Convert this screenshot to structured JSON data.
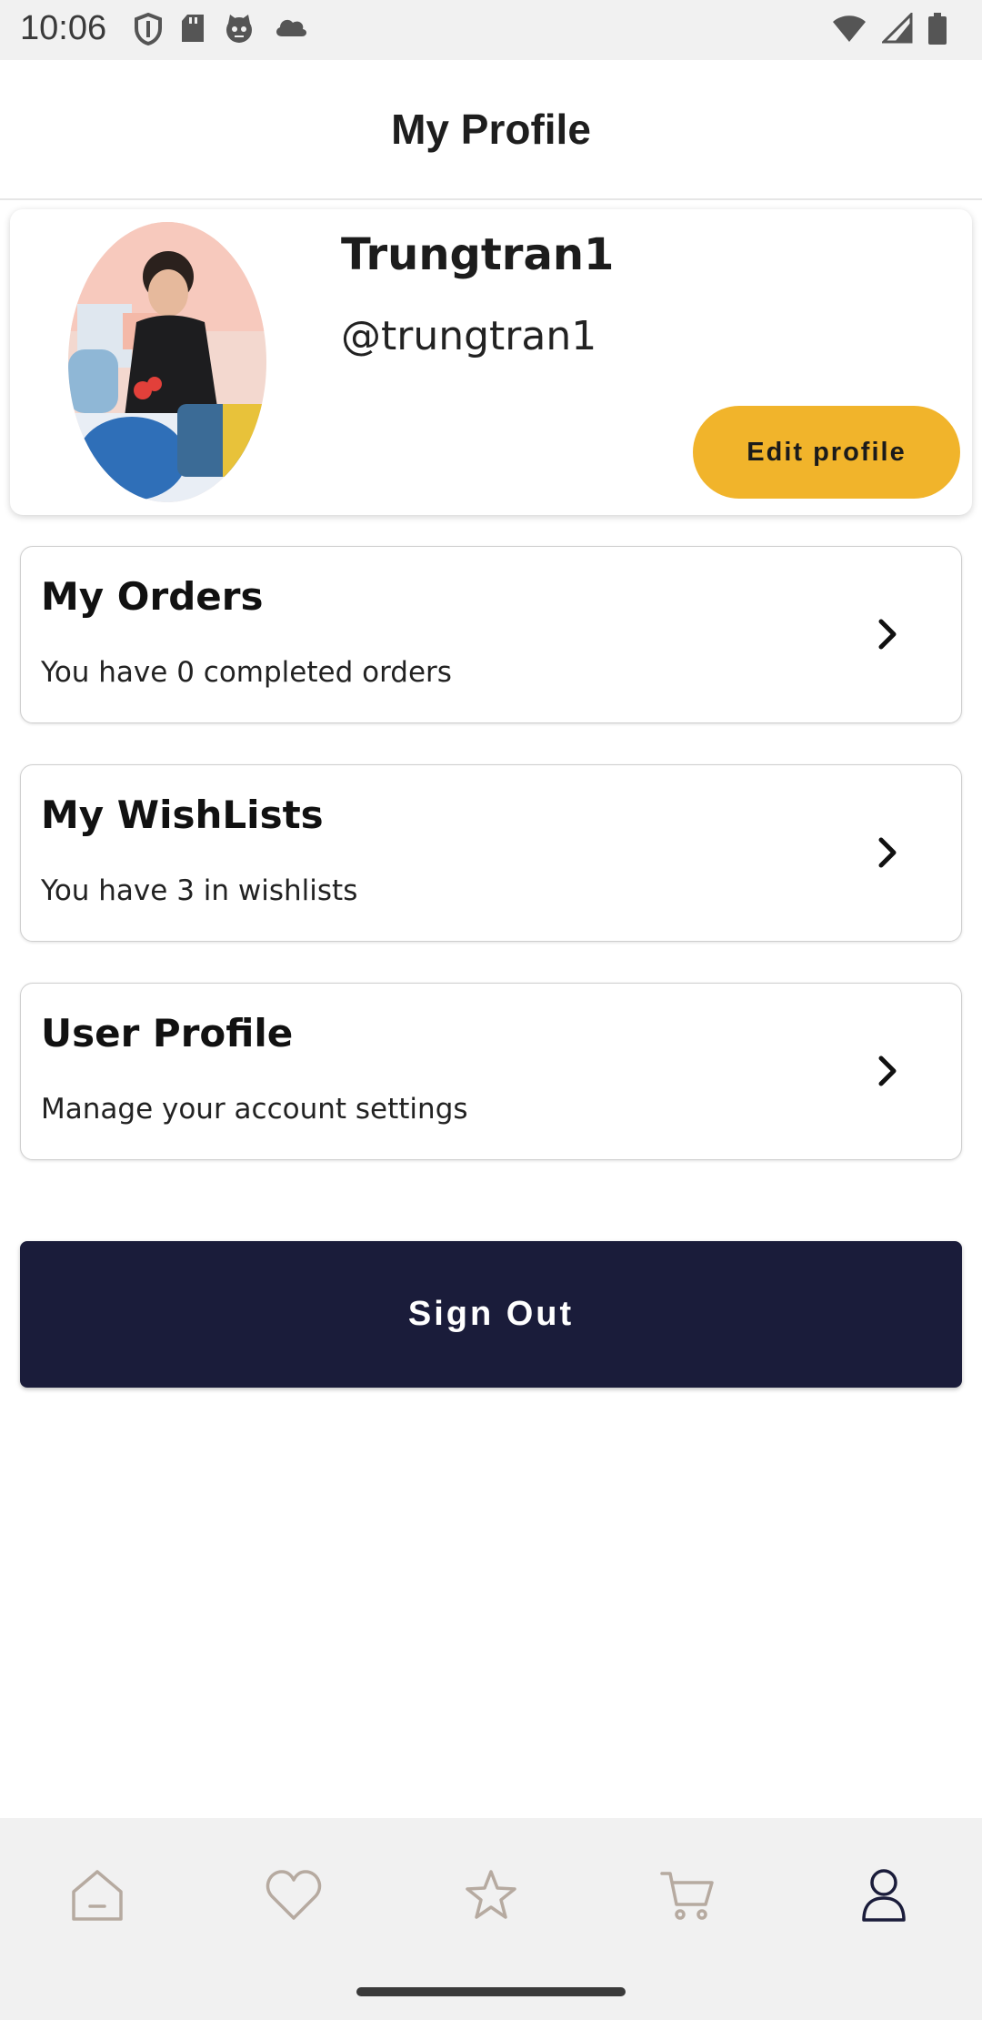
{
  "status_bar": {
    "time": "10:06",
    "left_icons": [
      "shield-icon",
      "sd-card-icon",
      "cat-face-icon",
      "cloud-icon"
    ],
    "right_icons": [
      "wifi-icon",
      "cellular-signal-icon",
      "battery-icon"
    ]
  },
  "header": {
    "title": "My Profile"
  },
  "profile": {
    "display_name": "Trungtran1",
    "username": "@trungtran1",
    "edit_label": "Edit profile",
    "accent_color": "#f1b42b"
  },
  "menu": {
    "items": [
      {
        "title": "My Orders",
        "subtitle": "You have 0 completed orders"
      },
      {
        "title": "My WishLists",
        "subtitle": "You have 3 in wishlists"
      },
      {
        "title": "User Profile",
        "subtitle": "Manage your account settings"
      }
    ]
  },
  "sign_out": {
    "label": "Sign Out",
    "color": "#1a1c3a"
  },
  "bottom_nav": {
    "items": [
      "home-icon",
      "heart-icon",
      "star-icon",
      "cart-icon",
      "person-icon"
    ],
    "active": "person-icon"
  }
}
